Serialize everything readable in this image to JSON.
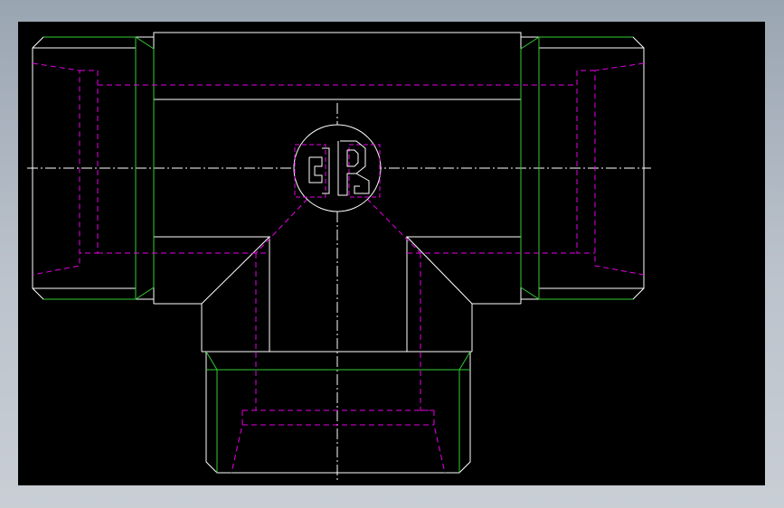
{
  "drawing": {
    "background_color": "#000000",
    "canvas_color": "#b6bec8",
    "colors": {
      "outline": "#ffffff",
      "thread": "#33cc33",
      "hidden": "#e600e6",
      "centerline": "#ffffff"
    },
    "views": [
      "front-view"
    ],
    "icons": [
      "logo-icon"
    ]
  }
}
